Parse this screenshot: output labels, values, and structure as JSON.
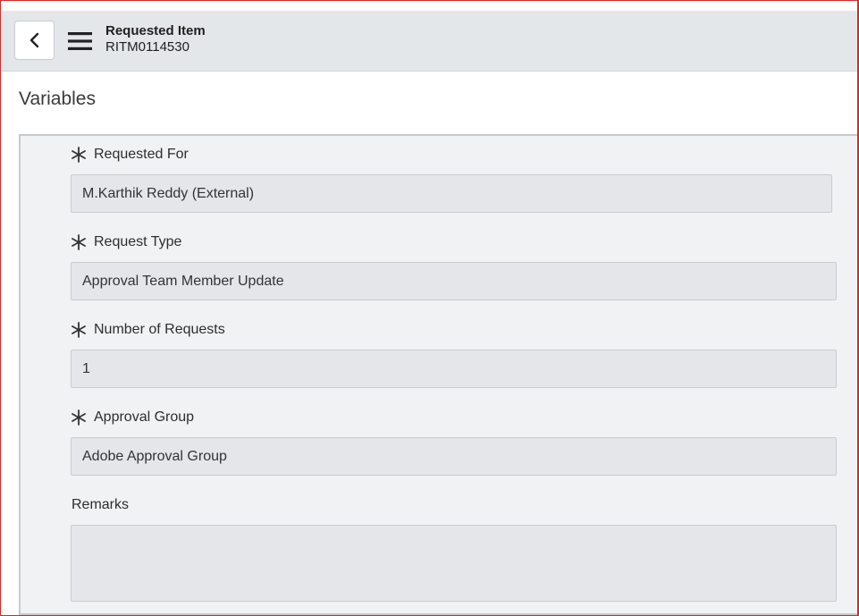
{
  "header": {
    "title": "Requested Item",
    "number": "RITM0114530"
  },
  "section": {
    "title": "Variables"
  },
  "fields": [
    {
      "label": "Requested For",
      "value": "M.Karthik Reddy (External)",
      "required": true
    },
    {
      "label": "Request Type",
      "value": "Approval Team Member Update",
      "required": true
    },
    {
      "label": "Number of Requests",
      "value": "1",
      "required": true
    },
    {
      "label": "Approval Group",
      "value": "Adobe Approval Group",
      "required": true
    },
    {
      "label": "Remarks",
      "value": "",
      "required": false
    }
  ],
  "icons": {
    "back": "chevron-left-icon",
    "menu": "hamburger-menu-icon",
    "required": "asterisk-icon"
  },
  "colors": {
    "header_bg": "#e4e7ea",
    "panel_bg": "#f1f2f4",
    "field_bg": "#e4e6e9",
    "frame_border": "#d22b2b"
  }
}
